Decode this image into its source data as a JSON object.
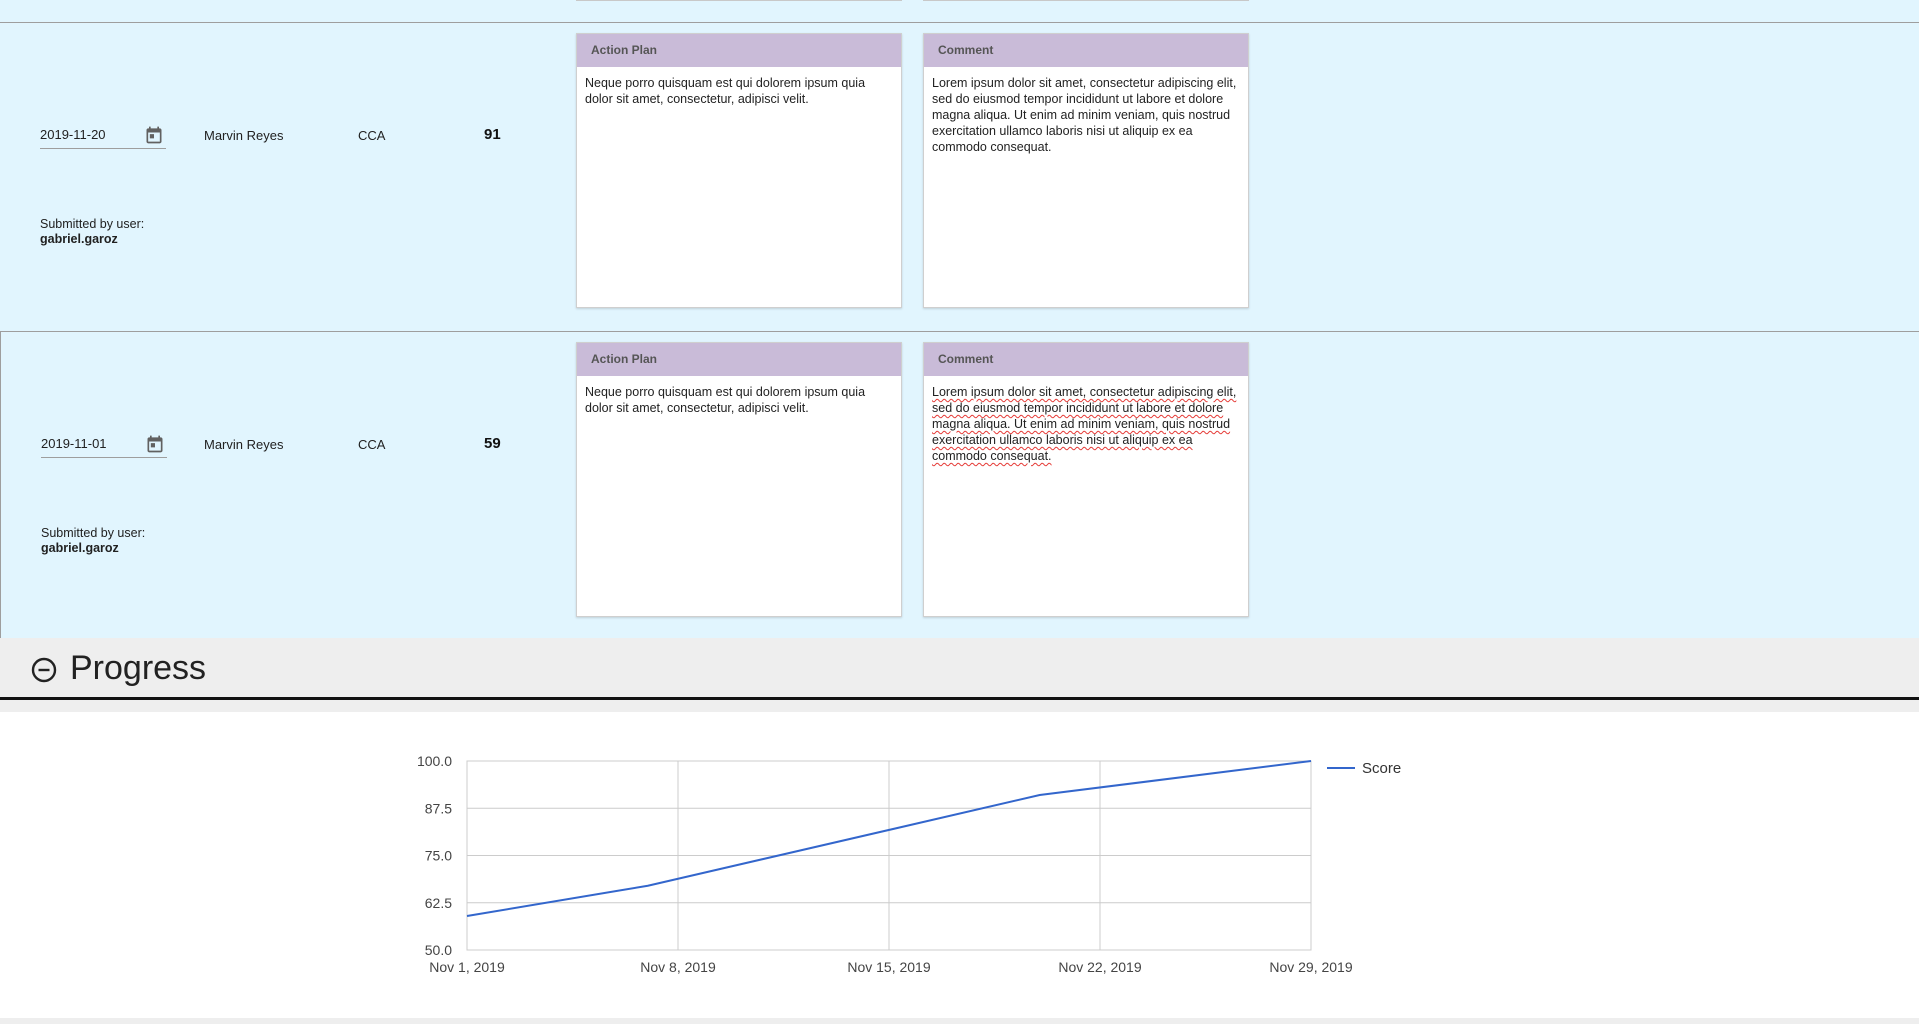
{
  "entries": [
    {
      "date": "2019-11-20",
      "name": "Marvin Reyes",
      "type": "CCA",
      "score": "91",
      "submitted_label": "Submitted by user:",
      "submitted_user": "gabriel.garoz",
      "action_plan": {
        "header": "Action Plan",
        "text": "Neque porro quisquam est qui dolorem ipsum quia dolor sit amet, consectetur, adipisci velit."
      },
      "comment": {
        "header": "Comment",
        "text": "Lorem ipsum dolor sit amet, consectetur adipiscing elit, sed do eiusmod tempor incididunt ut labore et dolore magna aliqua. Ut enim ad minim veniam, quis nostrud exercitation ullamco laboris nisi ut aliquip ex ea commodo consequat."
      }
    },
    {
      "date": "2019-11-01",
      "name": "Marvin Reyes",
      "type": "CCA",
      "score": "59",
      "submitted_label": "Submitted by user:",
      "submitted_user": "gabriel.garoz",
      "action_plan": {
        "header": "Action Plan",
        "text": "Neque porro quisquam est qui dolorem ipsum quia dolor sit amet, consectetur, adipisci velit."
      },
      "comment": {
        "header": "Comment",
        "text": "Lorem ipsum dolor sit amet, consectetur adipiscing elit, sed do eiusmod tempor incididunt ut labore et dolore magna aliqua. Ut enim ad minim veniam, quis nostrud exercitation ullamco laboris nisi ut aliquip ex ea commodo consequat."
      }
    }
  ],
  "progress": {
    "title": "Progress",
    "icon": "minus-circle-icon"
  },
  "colors": {
    "row_bg": "#e1f5fe",
    "card_header": "#c9bbd8",
    "line": "#3366cc"
  },
  "chart_data": {
    "type": "line",
    "x": [
      "2019-11-01",
      "2019-11-07",
      "2019-11-20",
      "2019-11-29"
    ],
    "series": [
      {
        "name": "Score",
        "values": [
          59,
          67,
          91,
          100
        ]
      }
    ],
    "y_ticks": [
      "50.0",
      "62.5",
      "75.0",
      "87.5",
      "100.0"
    ],
    "x_ticks": [
      "Nov 1, 2019",
      "Nov 8, 2019",
      "Nov 15, 2019",
      "Nov 22, 2019",
      "Nov 29, 2019"
    ],
    "ylim": [
      50,
      100
    ],
    "xlim": [
      "2019-11-01",
      "2019-11-29"
    ],
    "grid": true,
    "legend": "right"
  }
}
